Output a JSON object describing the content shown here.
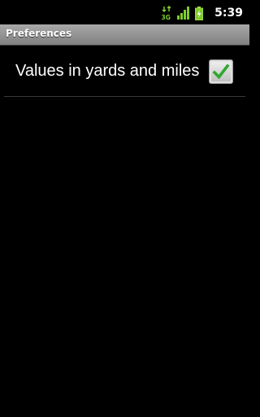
{
  "status_bar": {
    "network_type": "3G",
    "clock": "5:39",
    "signal_icon": "signal-bars-icon",
    "battery_icon": "battery-charging-icon",
    "network_icon": "network-3g-icon"
  },
  "title_bar": {
    "title": "Preferences"
  },
  "preferences": {
    "items": [
      {
        "label": "Values in yards and miles",
        "checked": true
      }
    ]
  },
  "colors": {
    "background": "#000000",
    "title_bar": "#9a9a9a",
    "check_mark": "#2fa82f"
  }
}
